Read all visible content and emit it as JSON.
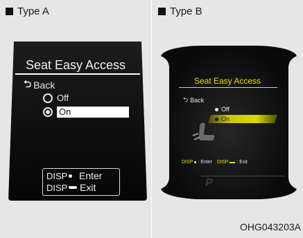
{
  "type_a": {
    "label": "Type A",
    "title": "Seat Easy Access",
    "back": "Back",
    "option_off": "Off",
    "option_on": "On",
    "legend_disp_1": "DISP",
    "legend_enter": "Enter",
    "legend_disp_2": "DISP",
    "legend_exit": "Exit"
  },
  "type_b": {
    "label": "Type B",
    "title": "Seat Easy Access",
    "back": "Back",
    "option_off": "Off",
    "option_on": "On",
    "legend_disp_1": "DISP",
    "legend_enter": ": Enter",
    "legend_disp_2": "DISP",
    "legend_exit": ": Exit",
    "gear": "P"
  },
  "figure_code": "OHG043203A",
  "colors": {
    "accent_yellow": "#e8e000",
    "screen_bg": "#0a0a0a",
    "page_bg": "#e6e6e6"
  }
}
